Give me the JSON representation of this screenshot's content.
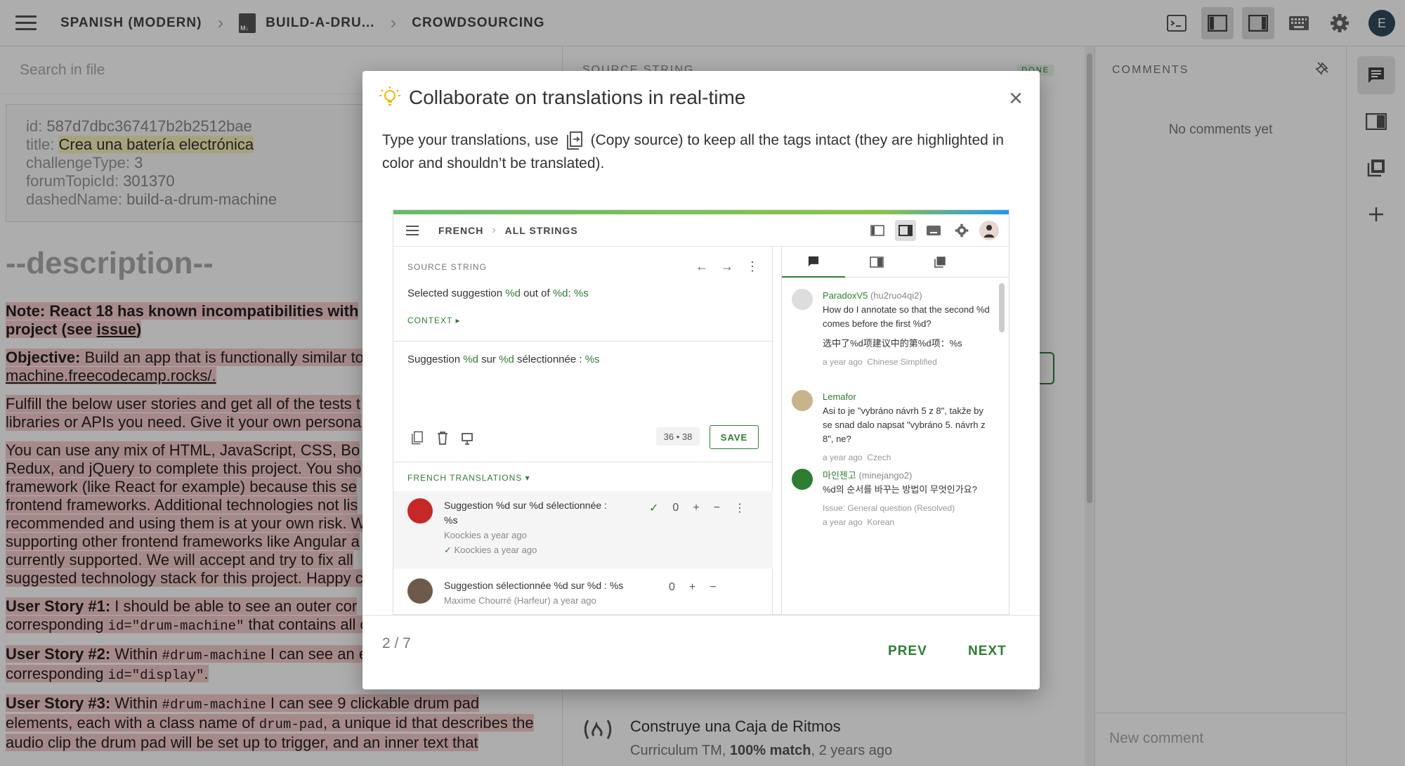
{
  "topbar": {
    "breadcrumbs": [
      "SPANISH (MODERN)",
      "BUILD-A-DRU...",
      "CROWDSOURCING"
    ],
    "avatar_letter": "E"
  },
  "left": {
    "search_placeholder": "Search in file",
    "meta": {
      "id_key": "id:",
      "id_val": "587d7dbc367417b2b2512bae",
      "title_key": "title:",
      "title_val": "Crea una batería electrónica",
      "ct_key": "challengeType:",
      "ct_val": "3",
      "ft_key": "forumTopicId:",
      "ft_val": "301370",
      "dn_key": "dashedName:",
      "dn_val": "build-a-drum-machine"
    },
    "heading": "--description--",
    "note1": "Note: React 18 has known incompatibilities with",
    "note2": "project (see ",
    "note_link": "issue",
    "note3": ")",
    "obj_label": "Objective:",
    "obj_text": " Build an app that is functionally similar to",
    "obj_link": "machine.freecodecamp.rocks/.",
    "fulfill1": "Fulfill the below user stories and get all of the tests t",
    "fulfill2": "libraries or APIs you need. Give it your own persona",
    "mix1": "You can use any mix of HTML, JavaScript, CSS, Bo",
    "mix2": "Redux, and jQuery to complete this project. You sho",
    "mix3": "framework (like React for example) because this se",
    "mix4": "frontend frameworks. Additional technologies not lis",
    "mix5": "recommended and using them is at your own risk. W",
    "mix6": "supporting other frontend frameworks like Angular a",
    "mix7": "currently supported. We will accept and try to fix all",
    "mix8": "suggested technology stack for this project. Happy c",
    "us1_label": "User Story #1:",
    "us1_text": " I should be able to see an outer cor",
    "us1_b": "corresponding ",
    "us1_code": "id=\"drum-machine\"",
    "us1_c": " that contains all o",
    "us2_label": "User Story #2:",
    "us2_a": " Within ",
    "us2_code": "#drum-machine",
    "us2_b": " I can see an e",
    "us2_c": "corresponding ",
    "us2_code2": "id=\"display\"",
    "us2_d": ".",
    "us3_label": "User Story #3:",
    "us3_a": " Within ",
    "us3_code": "#drum-machine",
    "us3_b": " I can see 9 clickable drum pad",
    "us3_c": "elements, each with a class name of ",
    "us3_code2": "drum-pad",
    "us3_d": ", a unique id that describes the",
    "us3_e": "audio clip the drum pad will be set up to trigger, and an inner text that"
  },
  "middle": {
    "header": "SOURCE STRING",
    "done": "DONE",
    "tm_title": "Construye una Caja de Ritmos",
    "tm_source": "Curriculum TM, ",
    "tm_match": "100% match",
    "tm_age": ", 2 years ago"
  },
  "comments": {
    "header": "COMMENTS",
    "empty": "No comments yet",
    "new_placeholder": "New comment"
  },
  "modal": {
    "title": "Collaborate on translations in real-time",
    "body1": "Type your translations, use ",
    "body2": " (Copy source) to keep all the tags intact (they are highlighted in color and shouldn’t be translated).",
    "page": "2 / 7",
    "prev": "PREV",
    "next": "NEXT"
  },
  "shot": {
    "crumb1": "FRENCH",
    "crumb2": "ALL STRINGS",
    "source_label": "SOURCE STRING",
    "src_a": "Selected suggestion ",
    "src_b": "%d",
    "src_c": " out of ",
    "src_d": "%d",
    "src_e": ": ",
    "src_f": "%s",
    "context": "CONTEXT ▸",
    "tr_a": "Suggestion ",
    "tr_b": "%d",
    "tr_c": " sur ",
    "tr_d": "%d",
    "tr_e": " sélectionnée : ",
    "tr_f": "%s",
    "count": "36 • 38",
    "save": "SAVE",
    "french_tr": "FRENCH TRANSLATIONS ▾",
    "sugg1_line1": "Suggestion %d sur %d sélectionnée :",
    "sugg1_line2": "%s",
    "sugg1_author": "Koockies",
    "sugg1_time": " a year ago",
    "sugg1_approver": "Koockies",
    "sugg1_atime": " a year ago",
    "sugg1_votes": "0",
    "sugg2_text": "Suggestion sélectionnée %d sur %d : %s",
    "sugg2_author": "Maxime Chourré (Harfeur)",
    "sugg2_time": " a year ago",
    "sugg2_votes": "0",
    "c1_name": "ParadoxV5",
    "c1_handle": " (hu2ruo4qi2)",
    "c1_text": "How do I annotate so that the second %d comes before the first %d?",
    "c1_text2": "选中了%d项建议中的第%d项：%s",
    "c1_time": "a year ago",
    "c1_lang": "Chinese Simplified",
    "c2_name": "Lemafor",
    "c2_text": "Asi to je \"vybráno návrh 5 z 8\", takže by se snad dalo napsat \"vybráno 5. návrh z 8\", ne?",
    "c2_time": "a year ago",
    "c2_lang": "Czech",
    "c3_name": "마인젠고",
    "c3_handle": " (minejango2)",
    "c3_text": "%d의 순서를 바꾸는 방법이 무엇인가요?",
    "c3_issue": "Issue: General question (Resolved)",
    "c3_time": "a year ago",
    "c3_lang": "Korean"
  },
  "colors": {
    "accent": "#2e7d32",
    "highlight_red": "#f5cccb",
    "highlight_yellow": "#f6f0b8"
  }
}
